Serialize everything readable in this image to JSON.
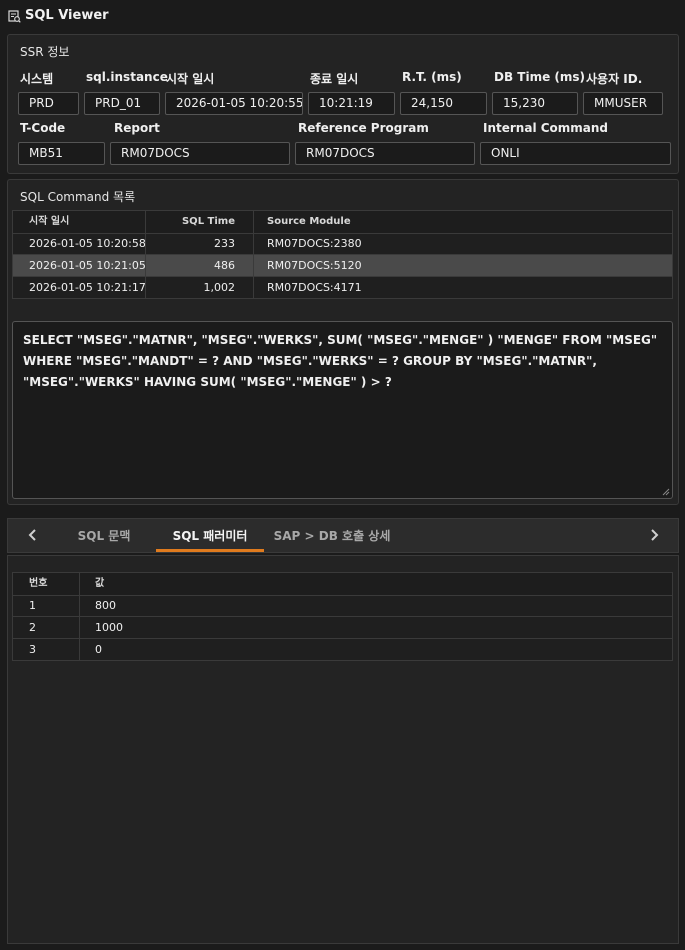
{
  "window": {
    "title": "SQL Viewer"
  },
  "ssr": {
    "title": "SSR 정보",
    "fields": [
      {
        "label": "시스템",
        "value": "PRD"
      },
      {
        "label": "sql.instance",
        "value": "PRD_01"
      },
      {
        "label": "시작 일시",
        "value": "2026-01-05 10:20:55"
      },
      {
        "label": "종료 일시",
        "value": "10:21:19"
      },
      {
        "label": "R.T. (ms)",
        "value": "24,150"
      },
      {
        "label": "DB Time (ms)",
        "value": "15,230"
      },
      {
        "label": "사용자 ID.",
        "value": "MMUSER"
      },
      {
        "label": "T-Code",
        "value": "MB51"
      },
      {
        "label": "Report",
        "value": "RM07DOCS"
      },
      {
        "label": "Reference Program",
        "value": "RM07DOCS"
      },
      {
        "label": "Internal Command",
        "value": "ONLI"
      }
    ]
  },
  "sql_list": {
    "title": "SQL Command 목록",
    "columns": [
      "시작 일시",
      "SQL Time",
      "Source Module"
    ],
    "rows": [
      [
        "2026-01-05 10:20:58",
        "233",
        "RM07DOCS:2380"
      ],
      [
        "2026-01-05 10:21:05",
        "486",
        "RM07DOCS:5120"
      ],
      [
        "2026-01-05 10:21:17",
        "1,002",
        "RM07DOCS:4171"
      ]
    ],
    "selected_row": 1
  },
  "sql_text": "SELECT \"MSEG\".\"MATNR\", \"MSEG\".\"WERKS\", SUM( \"MSEG\".\"MENGE\" ) \"MENGE\" FROM \"MSEG\" WHERE \"MSEG\".\"MANDT\" = ? AND \"MSEG\".\"WERKS\" = ? GROUP BY \"MSEG\".\"MATNR\", \"MSEG\".\"WERKS\" HAVING SUM( \"MSEG\".\"MENGE\" ) > ?",
  "tabs": {
    "items": [
      "SQL 문맥",
      "SQL 패러미터",
      "SAP > DB 호출 상세"
    ],
    "active": 1,
    "accent": "#e07b1e"
  },
  "params": {
    "columns": [
      "번호",
      "값"
    ],
    "rows": [
      [
        "1",
        "800"
      ],
      [
        "2",
        "1000"
      ],
      [
        "3",
        "0"
      ]
    ]
  }
}
